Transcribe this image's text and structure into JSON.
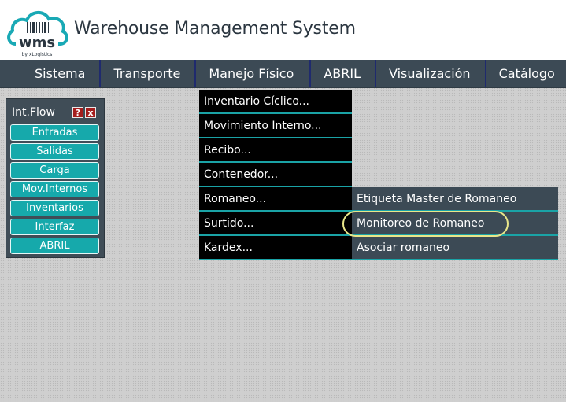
{
  "header": {
    "logo_text": "wms",
    "logo_subtext": "by xLogistics",
    "title": "Warehouse Management System"
  },
  "nav": {
    "items": [
      {
        "label": "Sistema"
      },
      {
        "label": "Transporte"
      },
      {
        "label": "Manejo Físico"
      },
      {
        "label": "ABRIL"
      },
      {
        "label": "Visualización"
      },
      {
        "label": "Catálogo"
      }
    ]
  },
  "panel": {
    "title": "Int.Flow",
    "help_icon": "?",
    "close_icon": "x",
    "buttons": [
      {
        "label": "Entradas"
      },
      {
        "label": "Salidas"
      },
      {
        "label": "Carga"
      },
      {
        "label": "Mov.Internos"
      },
      {
        "label": "Inventarios"
      },
      {
        "label": "Interfaz"
      },
      {
        "label": "ABRIL"
      }
    ]
  },
  "menu": {
    "items": [
      {
        "label": "Inventario Cíclico..."
      },
      {
        "label": "Movimiento Interno..."
      },
      {
        "label": "Recibo..."
      },
      {
        "label": "Contenedor..."
      },
      {
        "label": "Romaneo..."
      },
      {
        "label": "Surtido..."
      },
      {
        "label": "Kardex..."
      }
    ]
  },
  "submenu": {
    "items": [
      {
        "label": "Etiqueta Master de Romaneo"
      },
      {
        "label": "Monitoreo de Romaneo"
      },
      {
        "label": "Asociar romaneo"
      }
    ]
  },
  "colors": {
    "nav_bg": "#3c4a55",
    "button_teal": "#16a9ab",
    "menu_bg": "#000000",
    "highlight": "#e9e68a"
  }
}
